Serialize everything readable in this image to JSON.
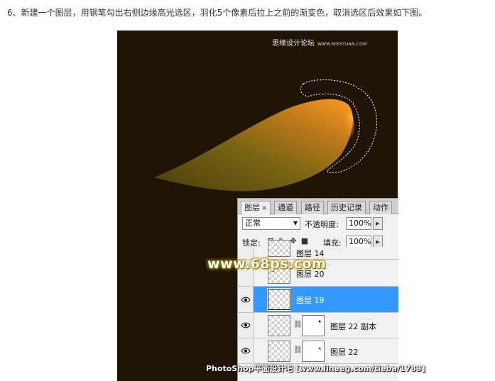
{
  "instruction": "6、新建一个图层，用钢笔勾出右侧边缘高光选区，羽化5个像素后拉上之前的渐变色，取消选区后效果如下图。",
  "watermark_top": {
    "main": "思缘设计论坛",
    "url": "WWW.MISSYUAN.COM"
  },
  "watermark_logo": "www.68ps.com",
  "watermark_bottom": "PhotoShop平面设计吧 [www.lineeg.com/tieba/1783]",
  "colors": {
    "canvas_bg": "#1e1405",
    "selected_layer": "#3399ff",
    "shape_light": "#ff9a1f",
    "shape_dark": "#6b5a14"
  },
  "layers_panel": {
    "tabs": [
      {
        "label": "图层",
        "close": "×",
        "active": true
      },
      {
        "label": "通道"
      },
      {
        "label": "路径"
      },
      {
        "label": "历史记录"
      },
      {
        "label": "动作"
      }
    ],
    "blend_mode": "正常",
    "opacity_label": "不透明度:",
    "opacity_value": "100%",
    "lock_label": "锁定:",
    "fill_label": "填充:",
    "fill_value": "100%",
    "lock_icons": [
      "lock-transparent-icon",
      "lock-brush-icon",
      "lock-move-icon",
      "lock-all-icon"
    ],
    "layers": [
      {
        "name": "图层 14",
        "visible": false,
        "selected": false
      },
      {
        "name": "图层 20",
        "visible": false,
        "selected": false
      },
      {
        "name": "图层 19",
        "visible": true,
        "selected": true
      },
      {
        "name": "图层 22 副本",
        "visible": true,
        "selected": false,
        "has_mask": true
      },
      {
        "name": "图层 22",
        "visible": true,
        "selected": false,
        "has_mask": true
      }
    ]
  }
}
